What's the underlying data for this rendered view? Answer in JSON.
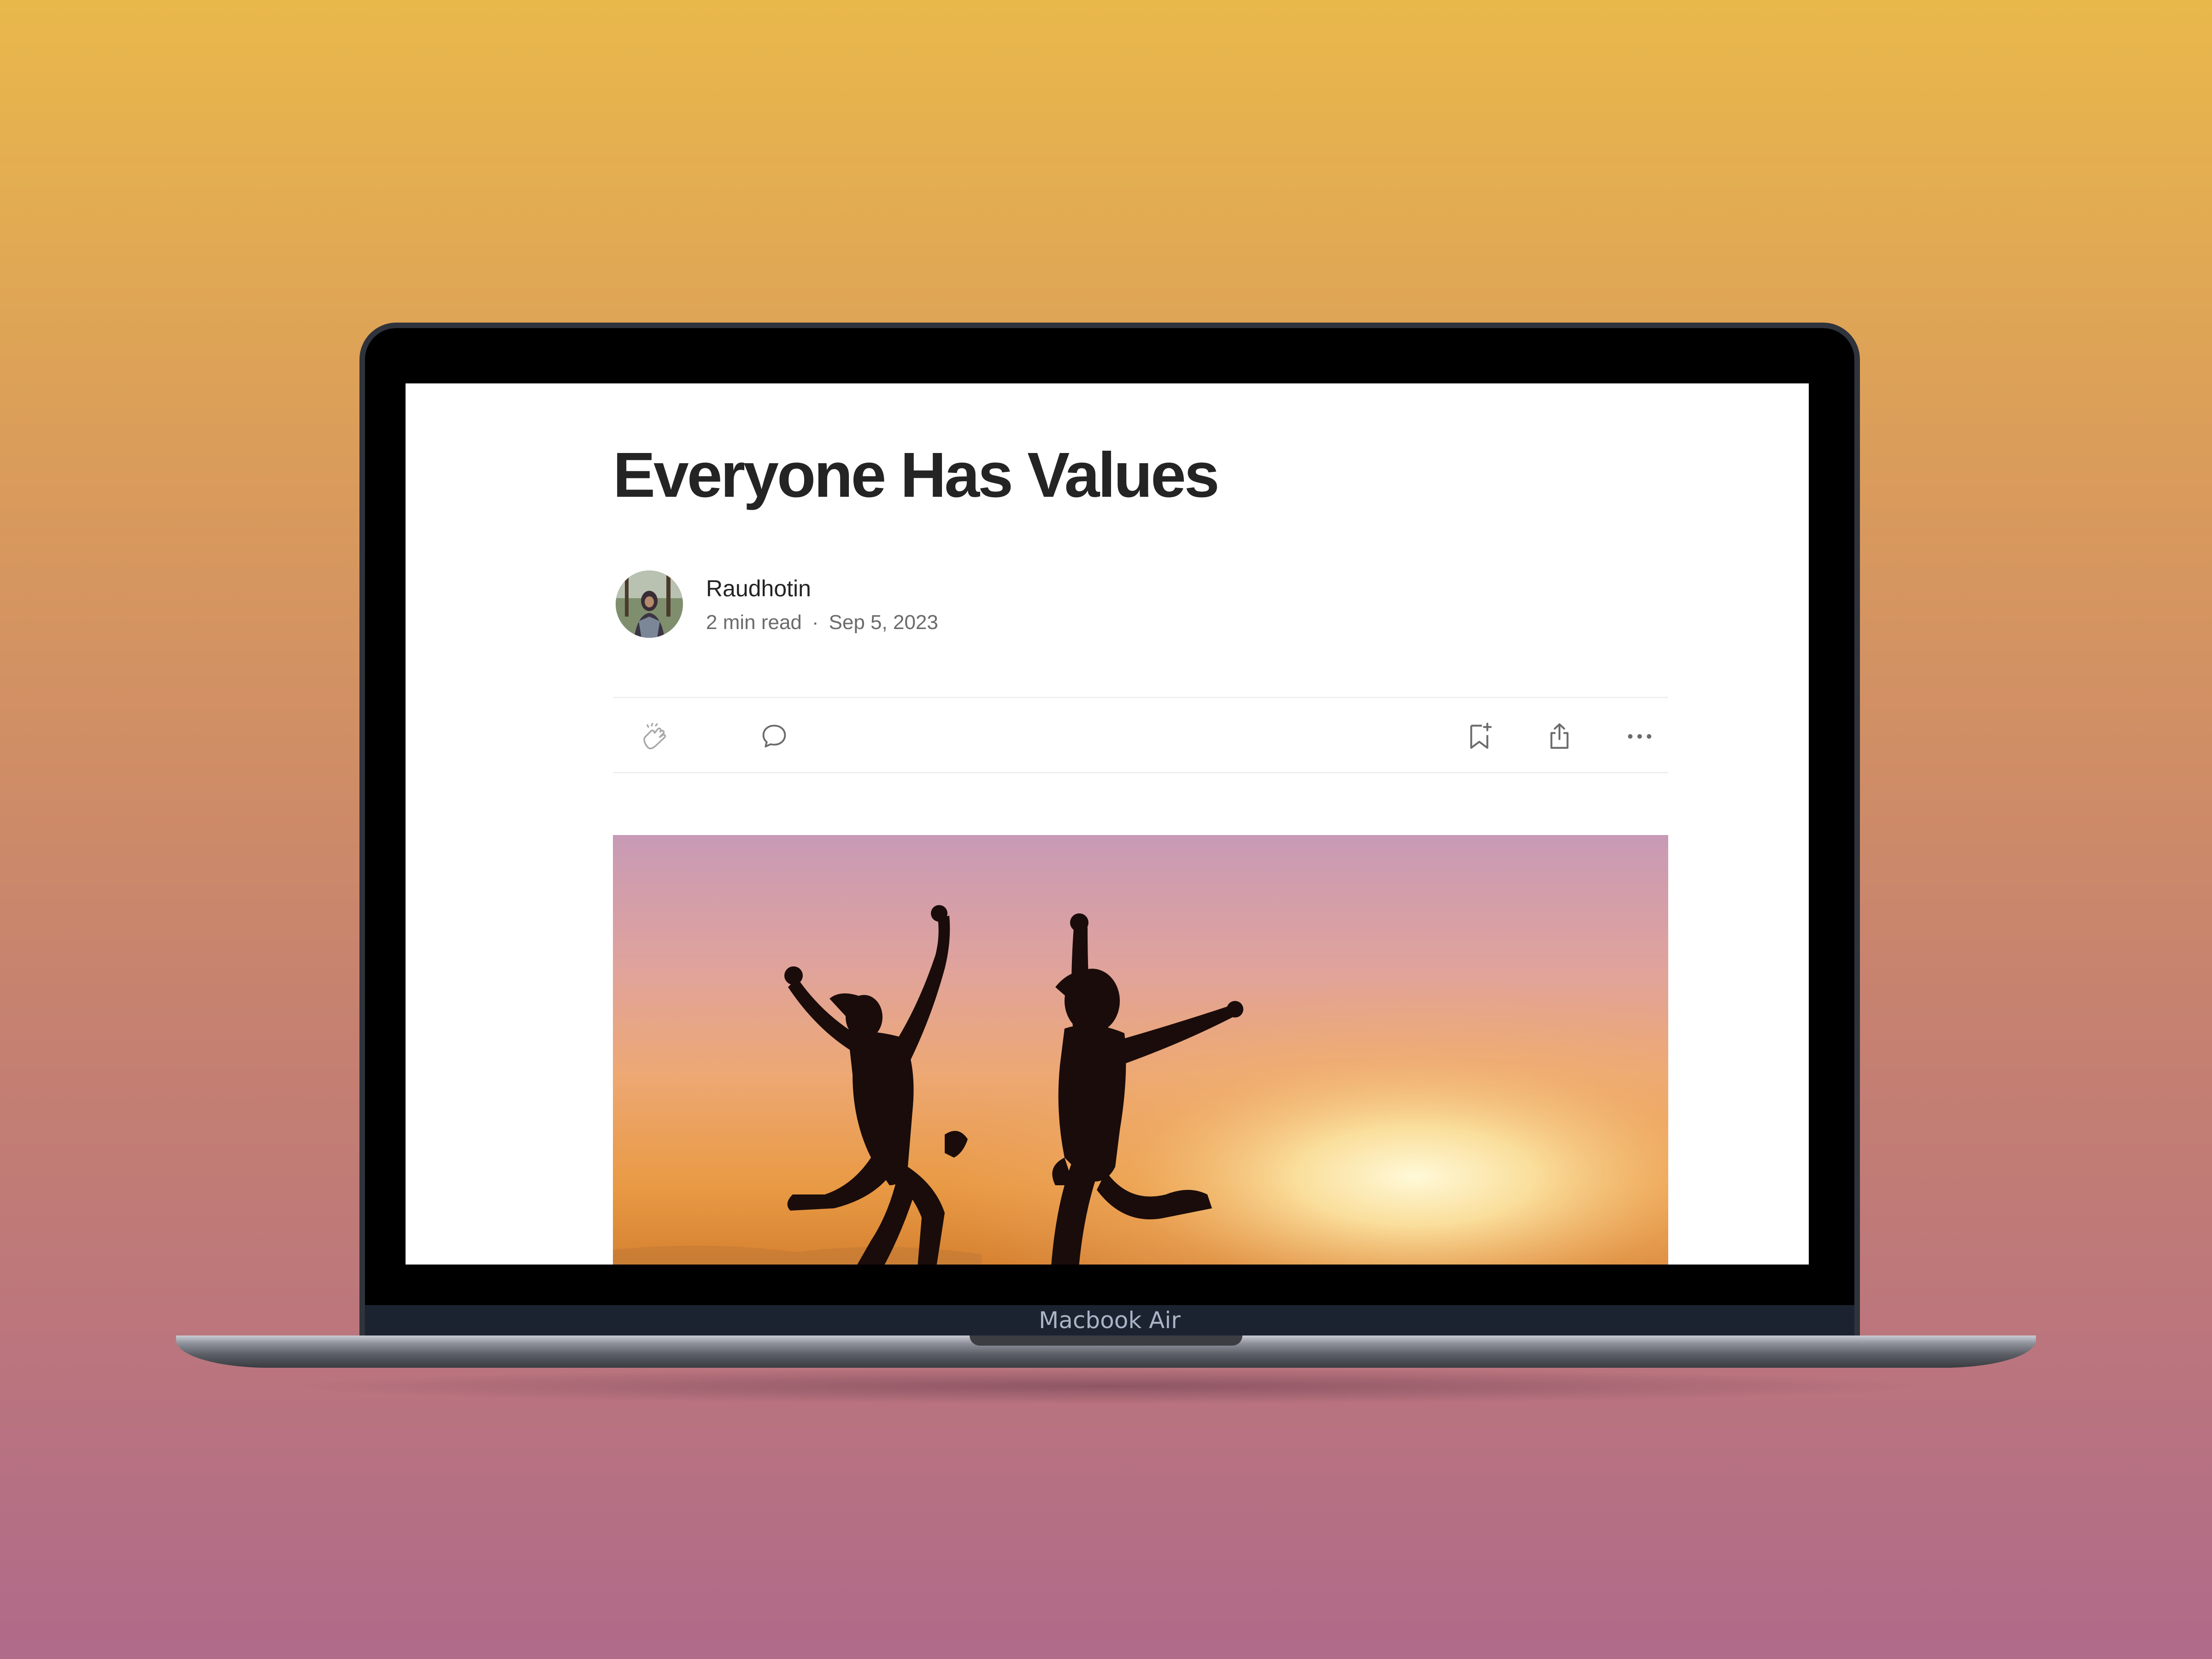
{
  "device": {
    "label": "Macbook Air"
  },
  "article": {
    "title": "Everyone Has Values",
    "author": {
      "name": "Raudhotin"
    },
    "read_time": "2 min read",
    "separator": "·",
    "date": "Sep 5, 2023"
  },
  "actions": {
    "left": [
      {
        "icon": "clap-icon"
      },
      {
        "icon": "comment-icon"
      }
    ],
    "right": [
      {
        "icon": "bookmark-add-icon"
      },
      {
        "icon": "share-icon"
      },
      {
        "icon": "more-icon"
      }
    ]
  },
  "hero_image": {
    "subject": "silhouettes-jumping-at-sunset"
  },
  "colors": {
    "title_text": "#242424",
    "meta_text": "#6b6b6b",
    "icon": "#6b6b6b",
    "divider": "#efefef"
  }
}
